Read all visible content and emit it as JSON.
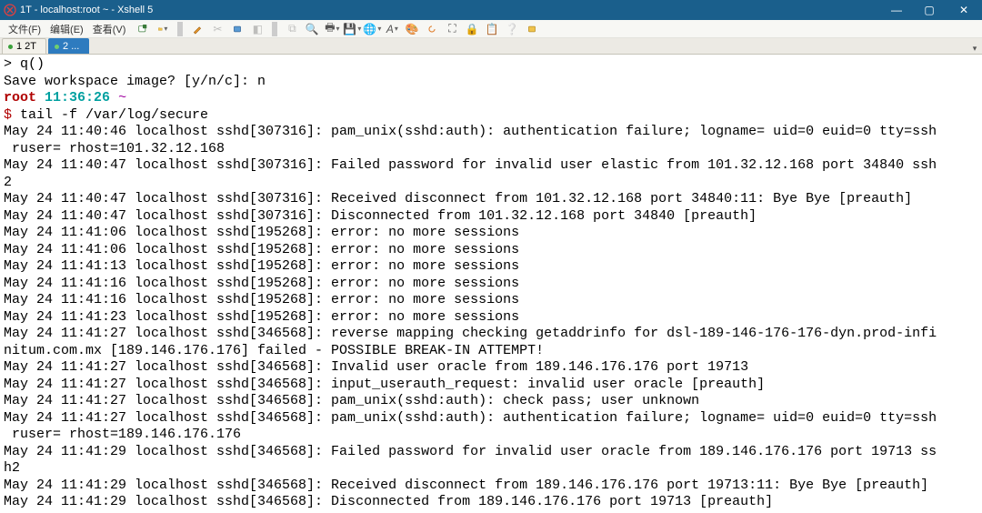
{
  "title": "1T - localhost:root ~ - Xshell 5",
  "menus": {
    "file": "文件(F)",
    "edit": "编辑(E)",
    "view": "查看(V)"
  },
  "tabs": [
    {
      "marker": "●",
      "label": "1 2T"
    },
    {
      "marker": "●",
      "label": "2 ..."
    }
  ],
  "term": {
    "l0": "> q()",
    "l1": "Save workspace image? [y/n/c]: n",
    "prompt_user": "root",
    "prompt_time": "11:36:26",
    "prompt_path": "~",
    "prompt_sym": "$",
    "cmd": " tail -f /var/log/secure",
    "lines": [
      "May 24 11:40:46 localhost sshd[307316]: pam_unix(sshd:auth): authentication failure; logname= uid=0 euid=0 tty=ssh",
      " ruser= rhost=101.32.12.168",
      "May 24 11:40:47 localhost sshd[307316]: Failed password for invalid user elastic from 101.32.12.168 port 34840 ssh",
      "2",
      "May 24 11:40:47 localhost sshd[307316]: Received disconnect from 101.32.12.168 port 34840:11: Bye Bye [preauth]",
      "May 24 11:40:47 localhost sshd[307316]: Disconnected from 101.32.12.168 port 34840 [preauth]",
      "May 24 11:41:06 localhost sshd[195268]: error: no more sessions",
      "May 24 11:41:06 localhost sshd[195268]: error: no more sessions",
      "May 24 11:41:13 localhost sshd[195268]: error: no more sessions",
      "May 24 11:41:16 localhost sshd[195268]: error: no more sessions",
      "May 24 11:41:16 localhost sshd[195268]: error: no more sessions",
      "May 24 11:41:23 localhost sshd[195268]: error: no more sessions",
      "May 24 11:41:27 localhost sshd[346568]: reverse mapping checking getaddrinfo for dsl-189-146-176-176-dyn.prod-infi",
      "nitum.com.mx [189.146.176.176] failed - POSSIBLE BREAK-IN ATTEMPT!",
      "May 24 11:41:27 localhost sshd[346568]: Invalid user oracle from 189.146.176.176 port 19713",
      "May 24 11:41:27 localhost sshd[346568]: input_userauth_request: invalid user oracle [preauth]",
      "May 24 11:41:27 localhost sshd[346568]: pam_unix(sshd:auth): check pass; user unknown",
      "May 24 11:41:27 localhost sshd[346568]: pam_unix(sshd:auth): authentication failure; logname= uid=0 euid=0 tty=ssh",
      " ruser= rhost=189.146.176.176",
      "May 24 11:41:29 localhost sshd[346568]: Failed password for invalid user oracle from 189.146.176.176 port 19713 ss",
      "h2",
      "May 24 11:41:29 localhost sshd[346568]: Received disconnect from 189.146.176.176 port 19713:11: Bye Bye [preauth]",
      "May 24 11:41:29 localhost sshd[346568]: Disconnected from 189.146.176.176 port 19713 [preauth]"
    ]
  },
  "winbtns": {
    "min": "—",
    "max": "▢",
    "close": "✕"
  },
  "caret": "▾"
}
